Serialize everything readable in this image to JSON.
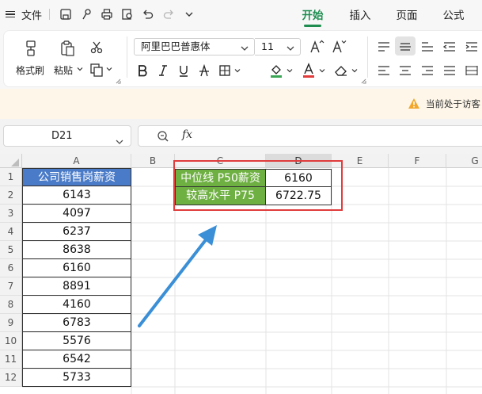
{
  "topbar": {
    "file_label": "文件",
    "tabs": [
      {
        "label": "开始",
        "active": true
      },
      {
        "label": "插入",
        "active": false
      },
      {
        "label": "页面",
        "active": false
      },
      {
        "label": "公式",
        "active": false
      }
    ]
  },
  "ribbon": {
    "format_painter_label": "格式刷",
    "paste_label": "粘贴",
    "font_name": "阿里巴巴普惠体",
    "font_size": "11"
  },
  "notice": {
    "text": "当前处于访客"
  },
  "formula_bar": {
    "cell_ref": "D21",
    "fx_label": "fx"
  },
  "grid": {
    "columns": [
      "A",
      "B",
      "C",
      "D",
      "E",
      "F",
      "G"
    ],
    "selected_column": "D",
    "rows": [
      "1",
      "2",
      "3",
      "4",
      "5",
      "6",
      "7",
      "8",
      "9",
      "10",
      "11",
      "12"
    ],
    "column_a": {
      "header": "公司销售岗薪资",
      "values": [
        "6143",
        "4097",
        "6237",
        "8638",
        "6160",
        "8891",
        "4160",
        "6783",
        "5576",
        "6542",
        "5733"
      ]
    },
    "summary": [
      {
        "label": "中位线 P50薪资",
        "value": "6160"
      },
      {
        "label": "较高水平 P75",
        "value": "6722.75"
      }
    ]
  },
  "colors": {
    "accent_green": "#1e8d4f",
    "header_blue": "#4a7bc8",
    "label_green": "#6fb043",
    "highlight_red": "#e03c3c",
    "arrow_blue": "#3a8fd6"
  }
}
